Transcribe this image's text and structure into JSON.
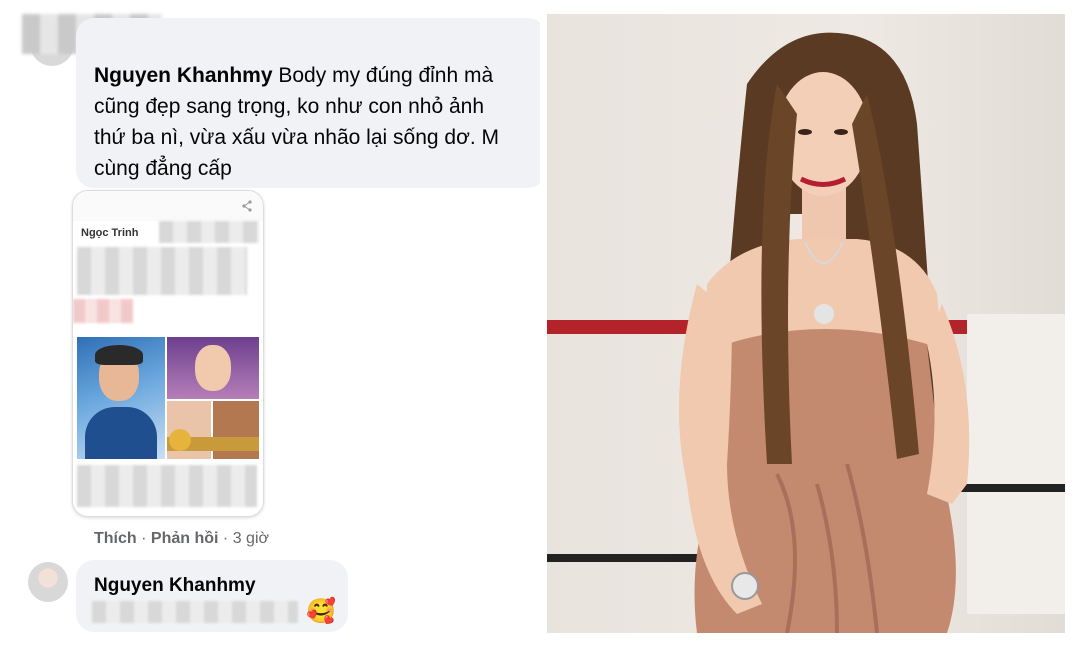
{
  "comment1": {
    "author": "Nguyen Khanhmy",
    "text": "Body my đúng đỉnh mà\ncũng đẹp sang trọng, ko như con nhỏ ảnh\nthứ ba nì, vừa xấu vừa nhão lại sống dơ. M\ncùng đẳng cấp"
  },
  "attachment": {
    "post_author": "Ngọc Trinh"
  },
  "actions": {
    "like": "Thích",
    "reply": "Phản hồi",
    "time": "3 giờ",
    "sep": "·"
  },
  "comment2": {
    "author": "Nguyen Khanhmy",
    "emoji": "🥰"
  },
  "icons": [
    "avatar",
    "emoji-icon",
    "share-icon"
  ],
  "colors": {
    "bubble": "#f0f2f5",
    "meta_text": "#65676b",
    "wall_stripe": "#b3242a",
    "dress": "#c48a70"
  }
}
